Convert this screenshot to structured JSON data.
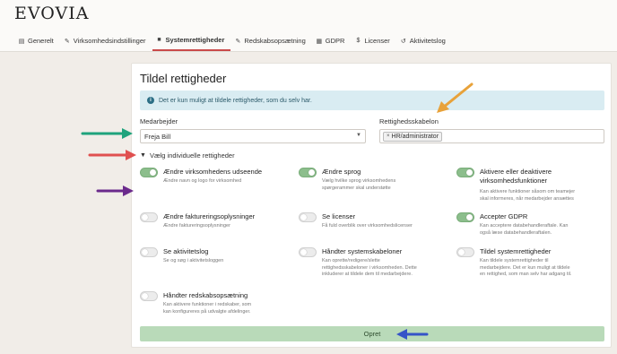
{
  "brand": "EVOVIA",
  "nav": [
    {
      "label": "Generelt",
      "icon": "document-icon"
    },
    {
      "label": "Virksomhedsindstillinger",
      "icon": "wrench-icon"
    },
    {
      "label": "Systemrettigheder",
      "icon": "lock-icon",
      "active": true
    },
    {
      "label": "Redskabsopsætning",
      "icon": "wrench-icon"
    },
    {
      "label": "GDPR",
      "icon": "table-icon"
    },
    {
      "label": "Licenser",
      "icon": "dollar-icon"
    },
    {
      "label": "Aktivitetslog",
      "icon": "history-icon"
    }
  ],
  "card": {
    "title": "Tildel rettigheder",
    "info": "Det er kun muligt at tildele rettigheder, som du selv har.",
    "employee_label": "Medarbejder",
    "employee_value": "Freja Bill",
    "template_label": "Rettighedsskabelon",
    "template_tag": "HR/administrator",
    "individual_toggle": "Vælg individuelle rettigheder",
    "submit": "Opret"
  },
  "permissions": [
    {
      "title": "Ændre virksomhedens udseende",
      "desc": [
        "Ændre navn og logo for virksomhed"
      ],
      "on": true
    },
    {
      "title": "Ændre sprog",
      "desc": [
        "Vælg hvilke sprog virksomhedens",
        "spørgerammer skal understøtte"
      ],
      "on": true
    },
    {
      "title": "Aktivere eller deaktivere virksomhedsfunktioner",
      "title2": "virksomhedsfunktioner",
      "desc": [
        "Kan aktivere funktioner såsom om teamejer",
        "skal informeres, når medarbejder ansættes"
      ],
      "on": true
    },
    {
      "title": "Ændre faktureringsoplysninger",
      "desc": [
        "Ændre faktureringsoplysninger"
      ],
      "on": false
    },
    {
      "title": "Se licenser",
      "desc": [
        "Få fuld overblik over virksomhedslicenser"
      ],
      "on": false
    },
    {
      "title": "Accepter GDPR",
      "desc": [
        "Kan acceptere databehandleraftale. Kan",
        "også læse databehandleraftalen."
      ],
      "on": true
    },
    {
      "title": "Se aktivitetslog",
      "desc": [
        "Se og søg i aktivitetsloggen"
      ],
      "on": false
    },
    {
      "title": "Håndter systemskabeloner",
      "desc": [
        "Kan oprette/redigere/slette",
        "rettighedsskabeloner i virksomheden. Dette",
        "inkluderer at tildele dem til medarbejdere."
      ],
      "on": false
    },
    {
      "title": "Tildel systemrettigheder",
      "desc": [
        "Kan tildele systemrettigheder til",
        "medarbejdere. Det er kun muligt at tildele",
        "en rettighed, som man selv har adgang til."
      ],
      "on": false
    },
    {
      "title": "Håndter redskabsopsætning",
      "desc": [
        "Kan aktivere funktioner i redskaber, som",
        "kan konfigureres på udvalgte afdelinger."
      ],
      "on": false
    }
  ],
  "annotations": {
    "colors": {
      "teal": "#1fa37c",
      "red": "#e0504f",
      "purple": "#6b2a8c",
      "orange": "#e8a23a",
      "blue": "#3553c8"
    }
  }
}
